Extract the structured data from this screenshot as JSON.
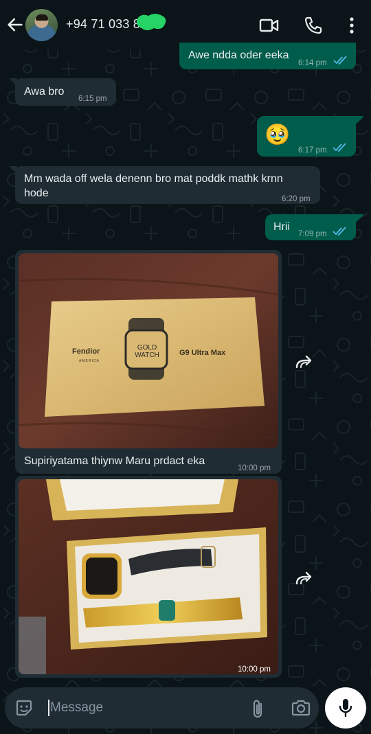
{
  "header": {
    "contact_name": "+94 71 033 86",
    "back_icon": "arrow-left-icon",
    "video_icon": "video-call-icon",
    "call_icon": "phone-icon",
    "menu_icon": "more-vertical-icon"
  },
  "messages": [
    {
      "type": "outgoing",
      "text": "Awe ndda oder eeka",
      "time": "6:14 pm",
      "status": "read"
    },
    {
      "type": "incoming",
      "text": "Awa bro",
      "time": "6:15 pm"
    },
    {
      "type": "outgoing",
      "text": "🥹",
      "time": "6:17 pm",
      "status": "read"
    },
    {
      "type": "incoming",
      "text": "Mm wada off wela denenn bro mat poddk mathk krnn hode",
      "time": "6:20 pm"
    },
    {
      "type": "outgoing",
      "text": "Hrii",
      "time": "7:09 pm",
      "status": "read"
    },
    {
      "type": "incoming-image",
      "caption": "Supiriyatama thiynw Maru prdact eka",
      "time": "10:00 pm",
      "image_labels": {
        "brand": "Fendior",
        "brand_sub": "AMERICA",
        "center": "GOLD WATCH",
        "model": "G9 Ultra Max"
      }
    },
    {
      "type": "incoming-image",
      "caption": "",
      "time": "10:00 pm"
    }
  ],
  "input": {
    "placeholder": "Message",
    "emoji_icon": "sticker-icon",
    "attach_icon": "paperclip-icon",
    "camera_icon": "camera-icon",
    "mic_icon": "microphone-icon"
  },
  "colors": {
    "background": "#0b1418",
    "outgoing_bubble": "#005c4b",
    "incoming_bubble": "#1f2c34",
    "read_ticks": "#53bdeb"
  }
}
